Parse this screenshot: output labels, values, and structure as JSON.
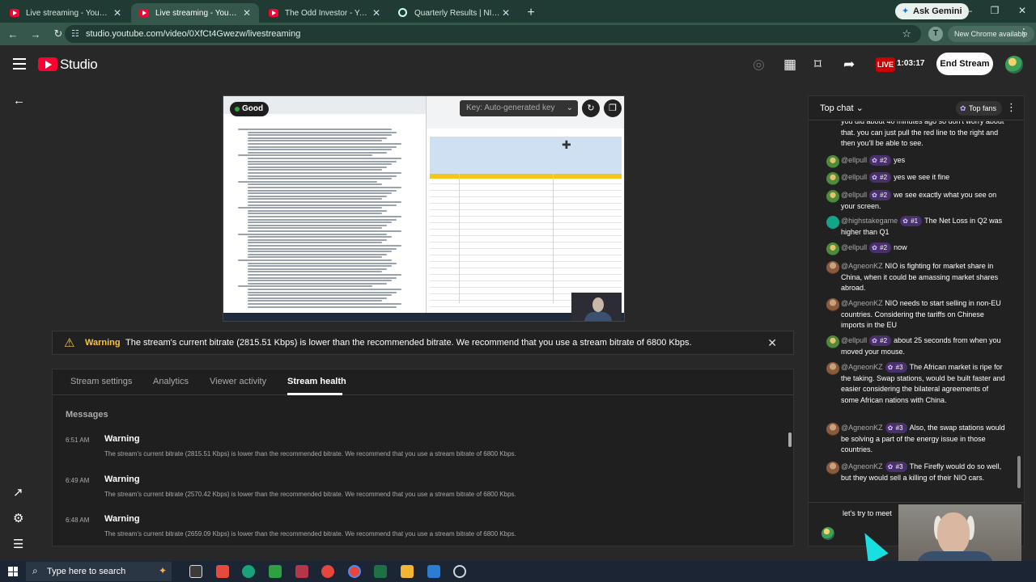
{
  "browser": {
    "tabs": [
      {
        "title": "Live streaming - YouTube Studio",
        "active": false
      },
      {
        "title": "Live streaming - YouTube Studio",
        "active": true
      },
      {
        "title": "The Odd Investor - YouTube",
        "active": false
      },
      {
        "title": "Quarterly Results | NIO Inc.",
        "active": false
      }
    ],
    "gemini_label": "Ask Gemini",
    "url": "studio.youtube.com/video/0XfCt4Gwezw/livestreaming",
    "profile_letter": "T",
    "new_chrome_label": "New Chrome available"
  },
  "header": {
    "logo_text": "Studio",
    "live_label": "LIVE",
    "live_time": "1:03:17",
    "end_stream_label": "End Stream"
  },
  "preview": {
    "health_label": "Good",
    "stream_key_placeholder": "Key: Auto-generated key"
  },
  "warning_banner": {
    "label": "Warning",
    "message": "The stream's current bitrate (2815.51 Kbps) is lower than the recommended bitrate. We recommend that you use a stream bitrate of 6800 Kbps."
  },
  "panel": {
    "tabs": [
      "Stream settings",
      "Analytics",
      "Viewer activity",
      "Stream health"
    ],
    "active_tab": "Stream health",
    "messages_heading": "Messages",
    "messages": [
      {
        "time": "6:51 AM",
        "title": "Warning",
        "body": "The stream's current bitrate (2815.51 Kbps) is lower than the recommended bitrate. We recommend that you use a stream bitrate of 6800 Kbps."
      },
      {
        "time": "6:49 AM",
        "title": "Warning",
        "body": "The stream's current bitrate (2570.42 Kbps) is lower than the recommended bitrate. We recommend that you use a stream bitrate of 6800 Kbps."
      },
      {
        "time": "6:48 AM",
        "title": "Warning",
        "body": "The stream's current bitrate (2659.09 Kbps) is lower than the recommended bitrate. We recommend that you use a stream bitrate of 6800 Kbps."
      }
    ]
  },
  "chat": {
    "mode_label": "Top chat",
    "top_fans_label": "Top fans",
    "messages": [
      {
        "user": "",
        "badge": "",
        "text": "you did about 40 minutes ago so don't worry about that. you can just pull the red line to the right and then you'll be able to see.",
        "avatar": "none"
      },
      {
        "user": "@ellpull",
        "badge": "#2",
        "text": "yes",
        "avatar": "ell"
      },
      {
        "user": "@ellpull",
        "badge": "#2",
        "text": "yes we see it fine",
        "avatar": "ell"
      },
      {
        "user": "@ellpull",
        "badge": "#2",
        "text": "we see exactly what you see on your screen.",
        "avatar": "ell"
      },
      {
        "user": "@highstakegame",
        "badge": "#1",
        "text": "The Net Loss in Q2 was higher than Q1",
        "avatar": "hs"
      },
      {
        "user": "@ellpull",
        "badge": "#2",
        "text": "now",
        "avatar": "ell"
      },
      {
        "user": "@AgneonKZ",
        "badge": "",
        "text": "NIO is fighting for market share in China, when it could be amassing market shares abroad.",
        "avatar": "ag"
      },
      {
        "user": "@AgneonKZ",
        "badge": "",
        "text": "NIO needs to start selling in non-EU countries. Considering the tariffs on Chinese imports in the EU",
        "avatar": "ag"
      },
      {
        "user": "@ellpull",
        "badge": "#2",
        "text": "about 25 seconds from when you moved your mouse.",
        "avatar": "ell"
      },
      {
        "user": "@AgneonKZ",
        "badge": "#3",
        "text": "The African market is ripe for the taking. Swap stations, would be built faster and easier considering the bilateral agreements of some African nations with China.",
        "avatar": "ag"
      },
      {
        "user": "@AgneonKZ",
        "badge": "#3",
        "text": "Also, the swap stations would be solving a part of the energy issue in those countries.",
        "avatar": "ag"
      },
      {
        "user": "@AgneonKZ",
        "badge": "#3",
        "text": "The Firefly would do so well, but they would sell a killing of their NIO cars.",
        "avatar": "ag"
      }
    ],
    "input_value": "let's try to meet"
  },
  "taskbar": {
    "search_placeholder": "Type here to search"
  }
}
